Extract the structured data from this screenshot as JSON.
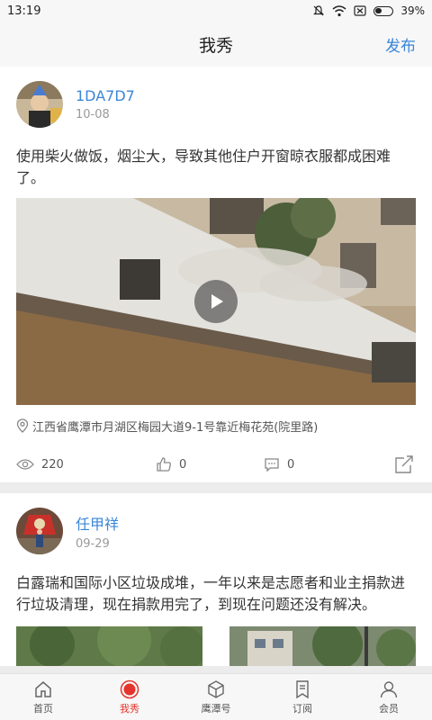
{
  "status": {
    "time": "13:19",
    "battery": "39%"
  },
  "nav": {
    "title": "我秀",
    "publish_label": "发布"
  },
  "posts": [
    {
      "user": "1DA7D7",
      "date": "10-08",
      "text": "使用柴火做饭，烟尘大，导致其他住户开窗晾衣服都成困难了。",
      "location": "江西省鹰潭市月湖区梅园大道9-1号靠近梅花苑(院里路)",
      "views": "220",
      "likes": "0",
      "comments": "0"
    },
    {
      "user": "任甲祥",
      "date": "09-29",
      "text": "白露瑞和国际小区垃圾成堆，一年以来是志愿者和业主捐款进行垃圾清理，现在捐款用完了，到现在问题还没有解决。"
    }
  ],
  "tabs": [
    {
      "label": "首页",
      "icon": "home-icon",
      "active": false
    },
    {
      "label": "我秀",
      "icon": "record-icon",
      "active": true
    },
    {
      "label": "鹰潭号",
      "icon": "cube-icon",
      "active": false
    },
    {
      "label": "订阅",
      "icon": "bookmark-icon",
      "active": false
    },
    {
      "label": "会员",
      "icon": "user-icon",
      "active": false
    }
  ],
  "colors": {
    "accent": "#3a86d8",
    "active_tab": "#e5342b"
  }
}
